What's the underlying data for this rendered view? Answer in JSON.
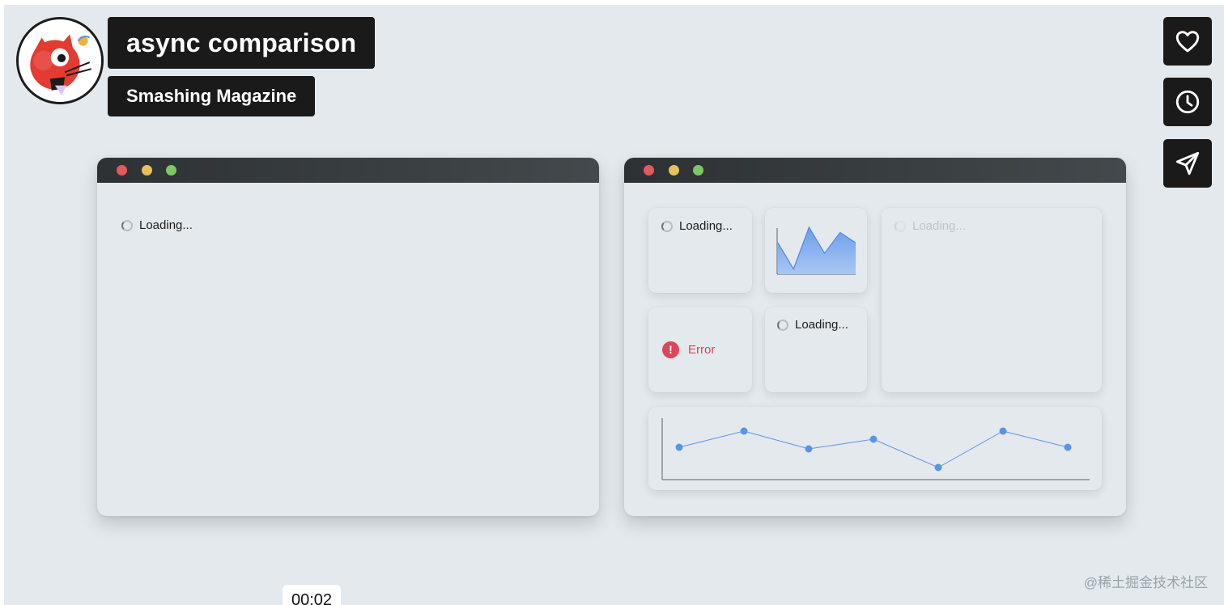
{
  "header": {
    "title": "async comparison",
    "subtitle": "Smashing Magazine"
  },
  "actions": [
    {
      "icon": "heart-icon"
    },
    {
      "icon": "clock-icon"
    },
    {
      "icon": "send-icon"
    }
  ],
  "left_window": {
    "loading_label": "Loading..."
  },
  "right_window": {
    "card_loading_1": "Loading...",
    "card_loading_2": "Loading...",
    "card_loading_3": "Loading...",
    "error_label": "Error",
    "area_chart_values": [
      6,
      1,
      9,
      4,
      8,
      6
    ],
    "line_chart_values": [
      4,
      6,
      3.8,
      5,
      1.5,
      6,
      4
    ]
  },
  "timer": "00:02",
  "watermark": "@稀土掘金技术社区",
  "colors": {
    "accent_blue": "#5b94e6",
    "error_red": "#e0455a",
    "panel_bg": "#e3e9ed",
    "dark_box": "#1a1a1a"
  }
}
